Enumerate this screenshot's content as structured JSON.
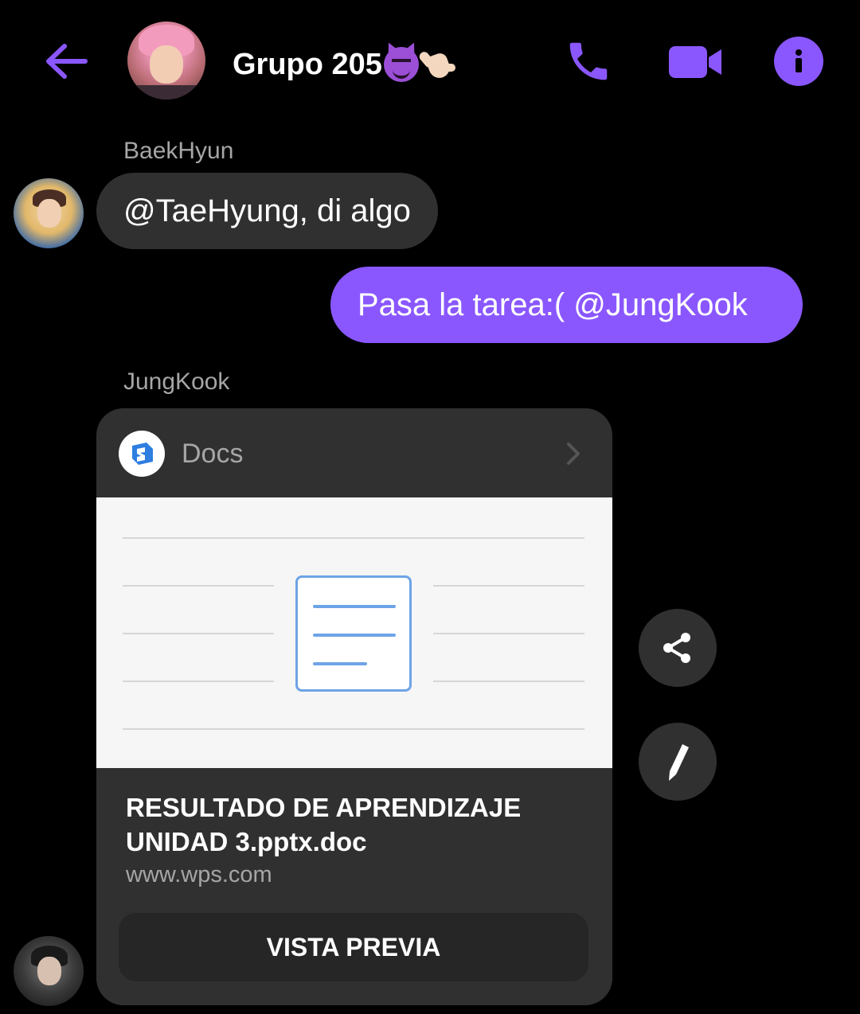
{
  "header": {
    "title": "Grupo 205",
    "title_emojis": [
      "smiling-devil",
      "call-me-hand"
    ],
    "accent_color": "#8a57ff"
  },
  "messages": [
    {
      "sender": "BaekHyun",
      "text": "@TaeHyung, di algo",
      "direction": "incoming"
    },
    {
      "sender": "",
      "text": "Pasa la tarea:( @JungKook",
      "direction": "outgoing"
    },
    {
      "sender": "JungKook",
      "direction": "incoming",
      "attachment": {
        "app_name": "Docs",
        "title_line1": "RESULTADO DE APRENDIZAJE",
        "title_line2": "UNIDAD 3.pptx.doc",
        "domain": "www.wps.com",
        "button_label": "VISTA PREVIA"
      }
    }
  ],
  "icons": {
    "back": "arrow-left-icon",
    "call": "phone-icon",
    "video": "video-camera-icon",
    "info": "info-icon",
    "share": "share-icon",
    "edit": "pencil-icon",
    "chevron": "chevron-right-icon",
    "document": "document-icon"
  },
  "colors": {
    "background": "#000000",
    "bubble_incoming": "#303030",
    "bubble_outgoing": "#8a57ff",
    "secondary_text": "#a6a6a6"
  }
}
